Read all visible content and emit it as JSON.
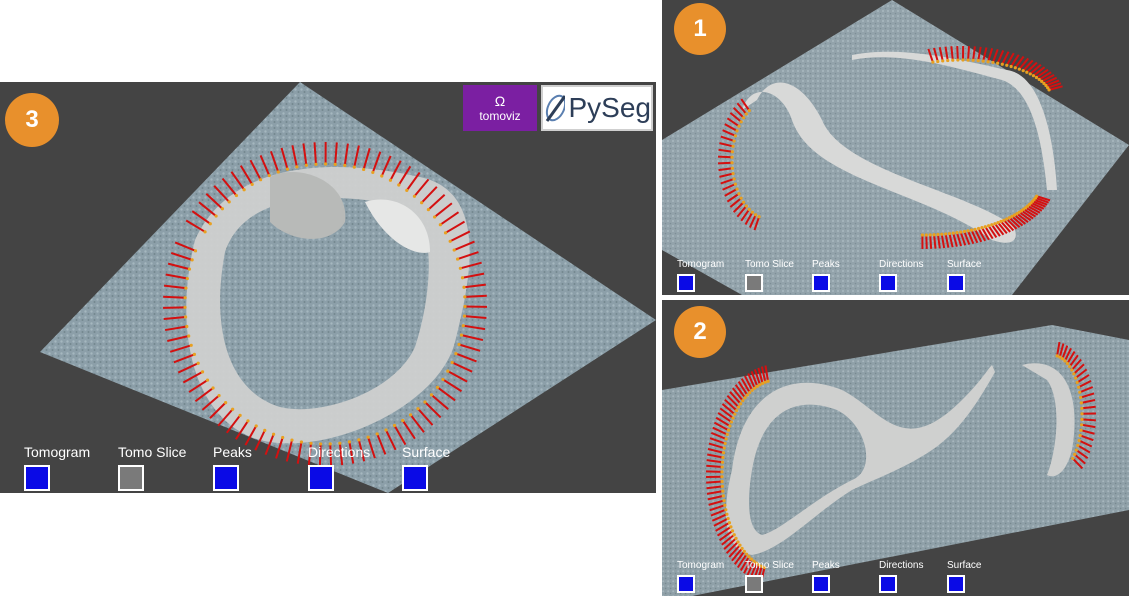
{
  "panels": [
    {
      "id": "3",
      "label": "3"
    },
    {
      "id": "1",
      "label": "1"
    },
    {
      "id": "2",
      "label": "2"
    }
  ],
  "toolbar": {
    "toggles": [
      {
        "label": "Tomogram",
        "state": "on"
      },
      {
        "label": "Tomo Slice",
        "state": "off"
      },
      {
        "label": "Peaks",
        "state": "on"
      },
      {
        "label": "Directions",
        "state": "on"
      },
      {
        "label": "Surface",
        "state": "on"
      }
    ]
  },
  "logos": {
    "tomoviz": "tomoviz",
    "pyseg": "PySeg"
  },
  "colors": {
    "viewport_bg": "#444444",
    "badge": "#e8902c",
    "toggle_on": "#0a0ae6",
    "toggle_off": "#7a7a7a",
    "arrows": "#d41010",
    "peaks": "#e8a020",
    "membrane": "#cfd0cf",
    "tomogram": "#8da3ad"
  }
}
